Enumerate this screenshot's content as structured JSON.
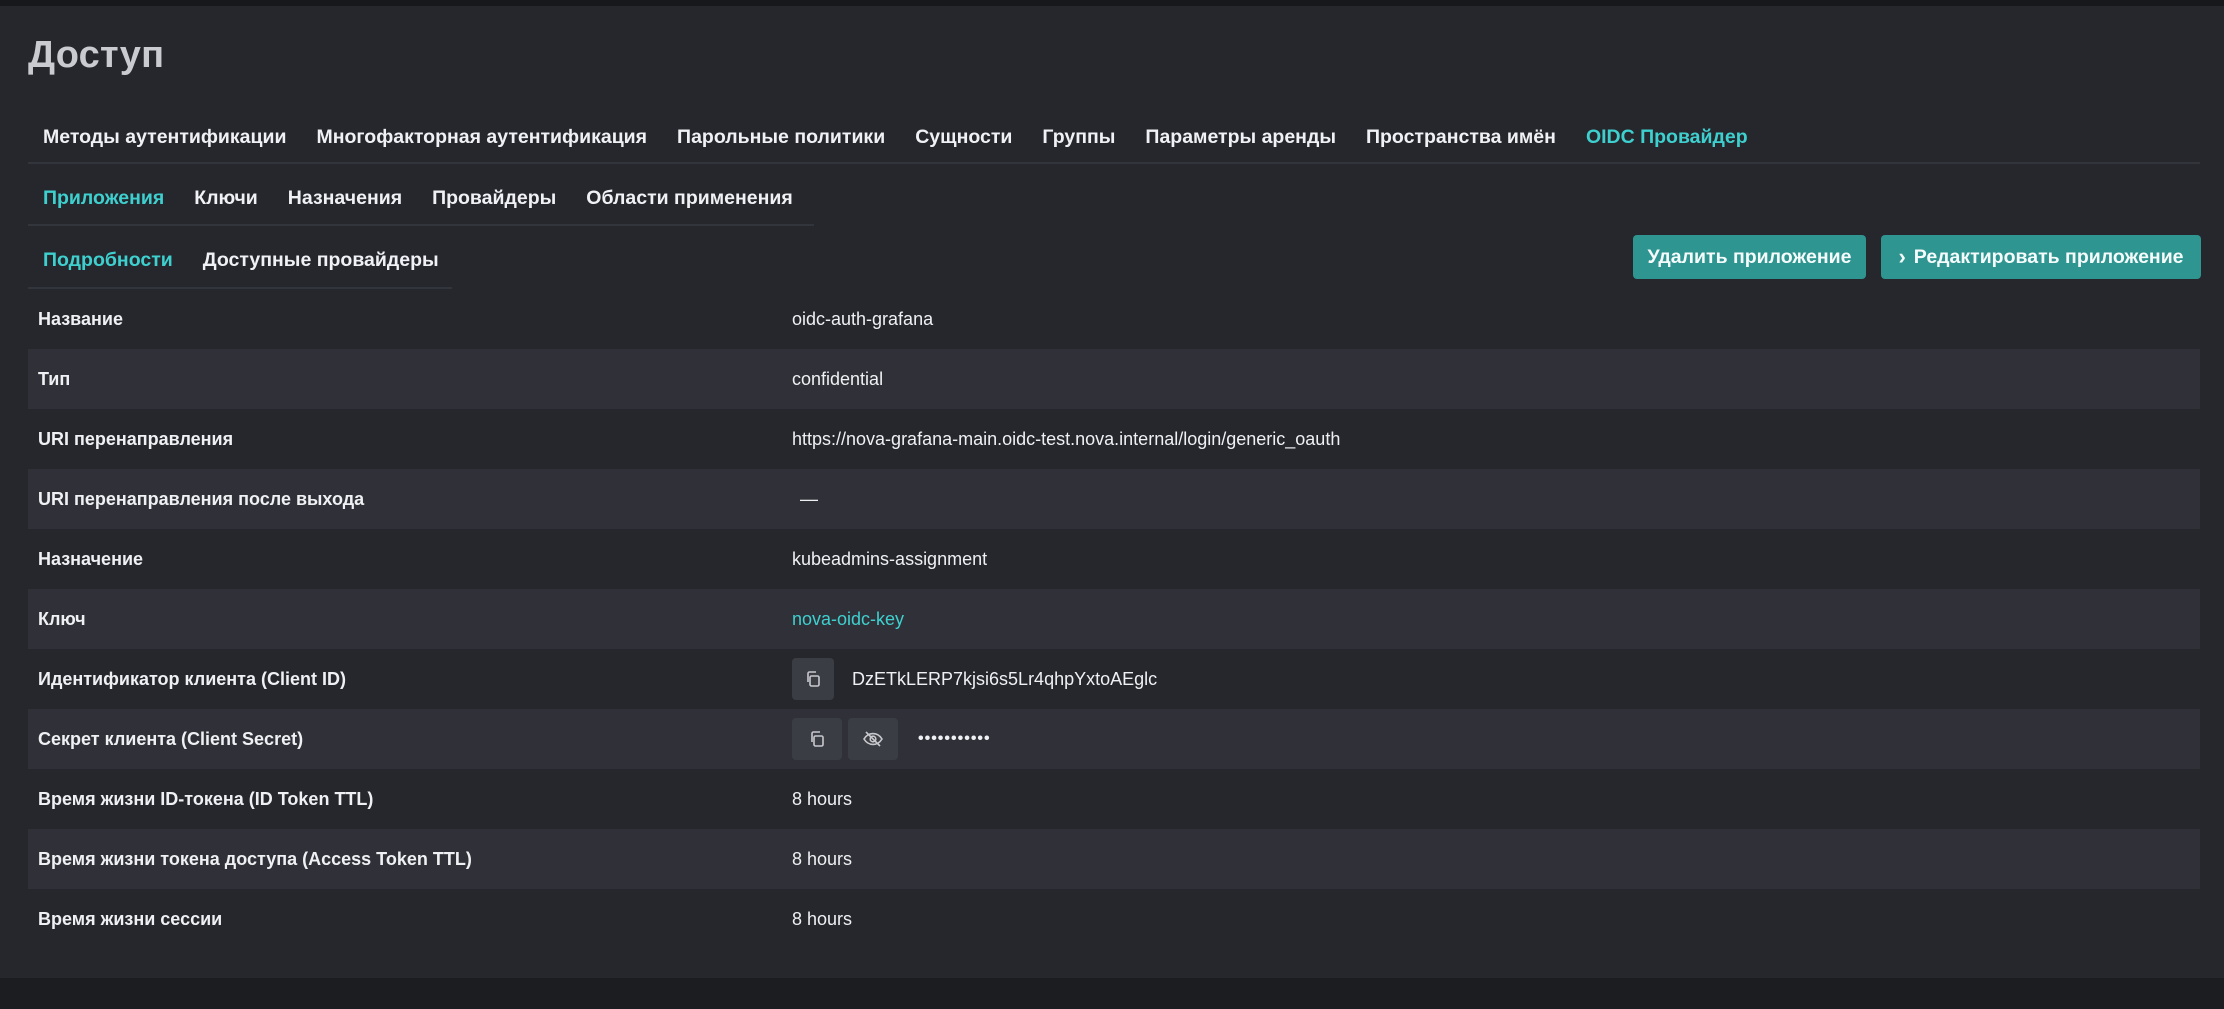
{
  "page": {
    "title": "Доступ"
  },
  "tabs_main": [
    {
      "label": "Методы аутентификации",
      "active": false
    },
    {
      "label": "Многофакторная аутентификация",
      "active": false
    },
    {
      "label": "Парольные политики",
      "active": false
    },
    {
      "label": "Сущности",
      "active": false
    },
    {
      "label": "Группы",
      "active": false
    },
    {
      "label": "Параметры аренды",
      "active": false
    },
    {
      "label": "Пространства имён",
      "active": false
    },
    {
      "label": "OIDC Провайдер",
      "active": true
    }
  ],
  "tabs_oidc": [
    {
      "label": "Приложения",
      "active": true
    },
    {
      "label": "Ключи",
      "active": false
    },
    {
      "label": "Назначения",
      "active": false
    },
    {
      "label": "Провайдеры",
      "active": false
    },
    {
      "label": "Области применения",
      "active": false
    }
  ],
  "tabs_app": [
    {
      "label": "Подробности",
      "active": true
    },
    {
      "label": "Доступные провайдеры",
      "active": false
    }
  ],
  "actions": {
    "delete_label": "Удалить приложение",
    "edit_label": "Редактировать приложение",
    "edit_icon": "chevron-right-icon"
  },
  "details": {
    "name": {
      "label": "Название",
      "value": "oidc-auth-grafana"
    },
    "type": {
      "label": "Тип",
      "value": "confidential"
    },
    "redirect_uri": {
      "label": "URI перенаправления",
      "value": "https://nova-grafana-main.oidc-test.nova.internal/login/generic_oauth"
    },
    "logout_redirect_uri": {
      "label": "URI перенаправления после выхода",
      "value": "—"
    },
    "assignment": {
      "label": "Назначение",
      "value": "kubeadmins-assignment"
    },
    "key": {
      "label": "Ключ",
      "value": "nova-oidc-key"
    },
    "client_id": {
      "label": "Идентификатор клиента (Client ID)",
      "value": "DzETkLERP7kjsi6s5Lr4qhpYxtoAEglc",
      "icon": "copy-icon"
    },
    "client_secret": {
      "label": "Секрет клиента (Client Secret)",
      "value": "•••••••••••",
      "icons": [
        "copy-icon",
        "eye-off-icon"
      ]
    },
    "id_token_ttl": {
      "label": "Время жизни ID-токена (ID Token TTL)",
      "value": "8 hours"
    },
    "access_token_ttl": {
      "label": "Время жизни токена доступа (Access Token TTL)",
      "value": "8 hours"
    },
    "session_ttl": {
      "label": "Время жизни сессии",
      "value": "8 hours"
    }
  },
  "colors": {
    "accent": "#3ed0cf",
    "button": "#2e9591",
    "background": "#26272d",
    "row_alt": "#303138"
  }
}
